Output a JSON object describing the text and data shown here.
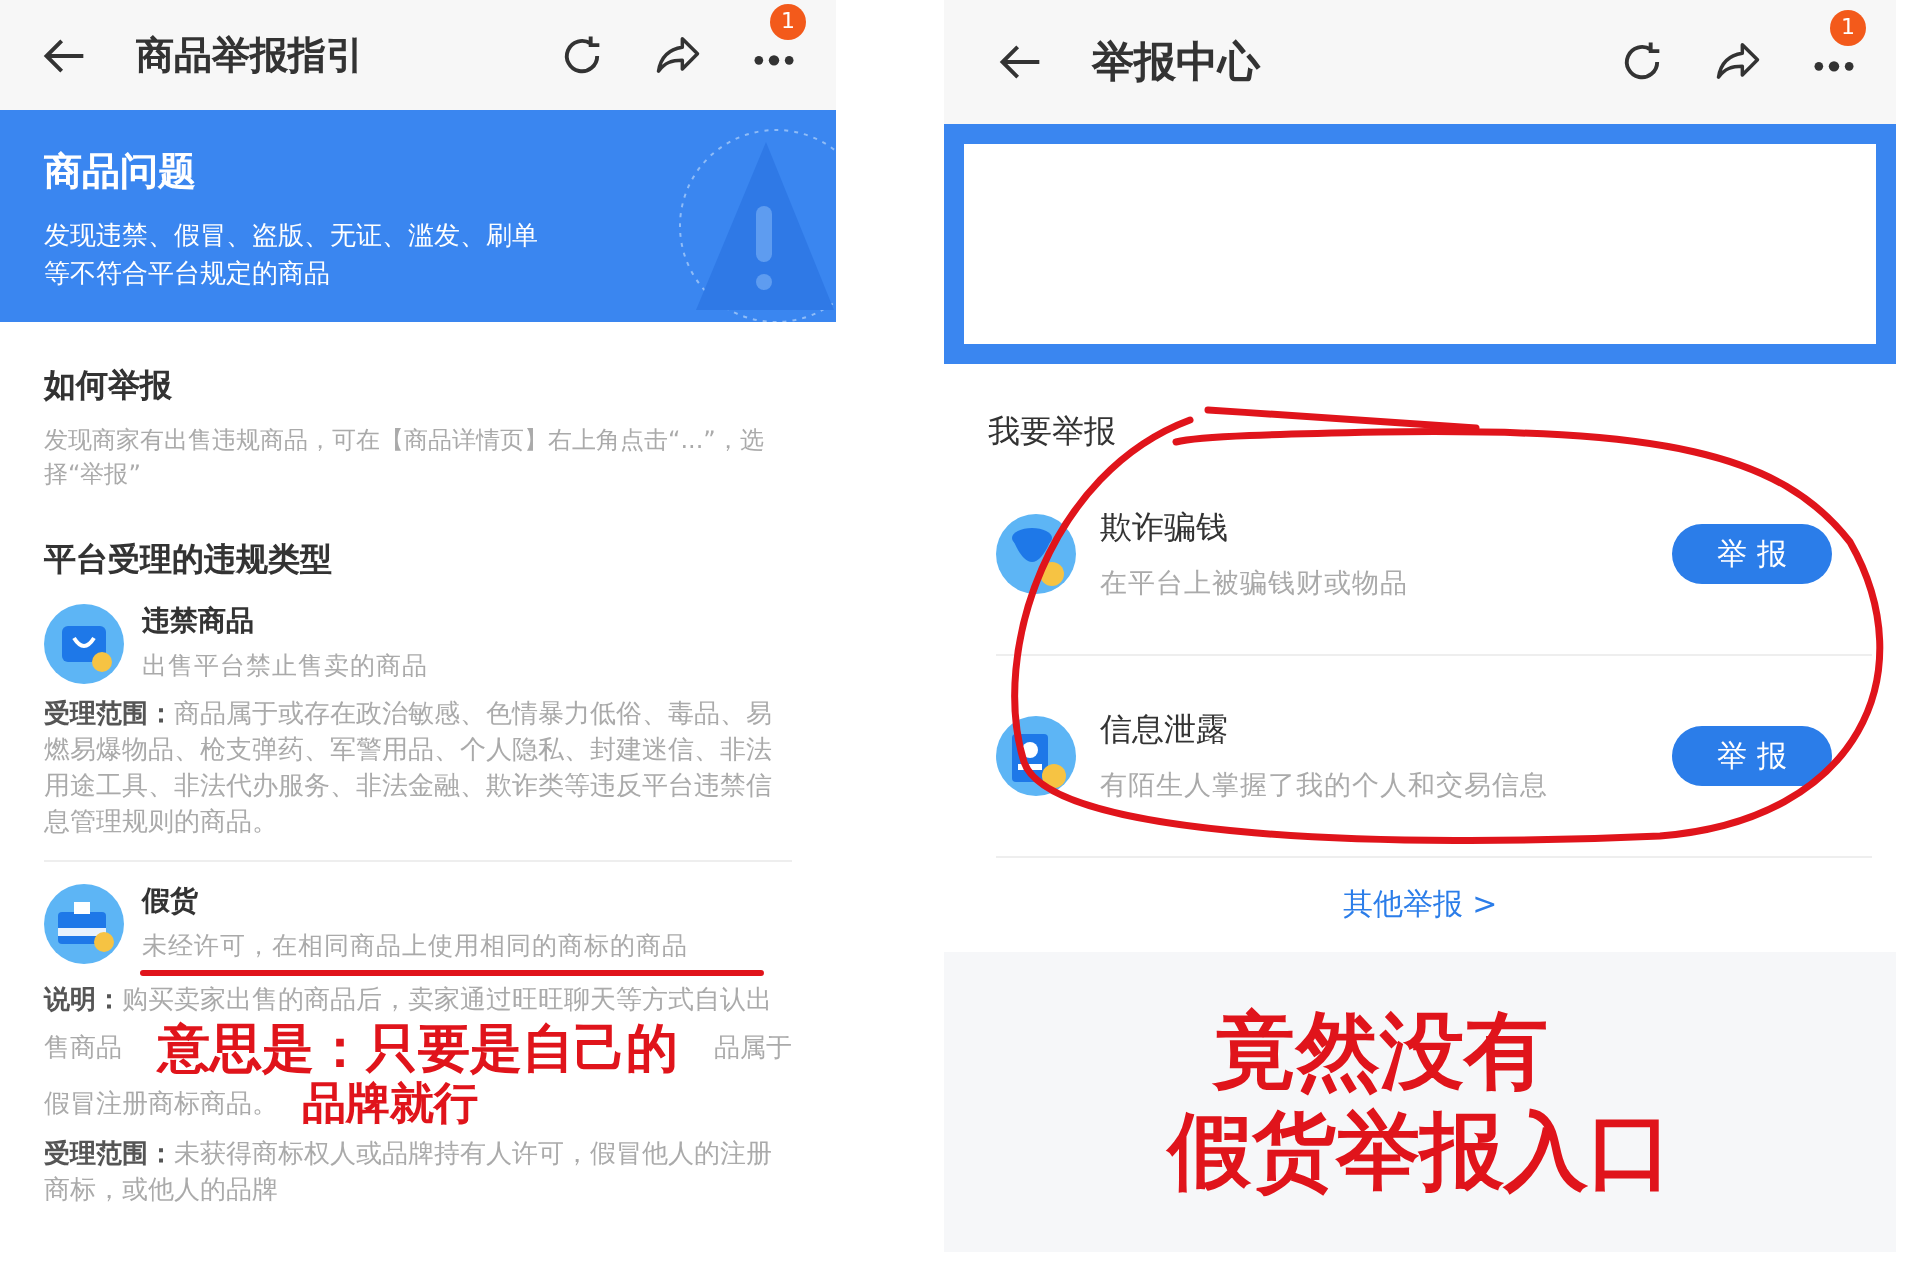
{
  "left_screen": {
    "header": {
      "title": "商品举报指引",
      "badge": "1"
    },
    "banner": {
      "title": "商品问题",
      "lines": [
        "发现违禁、假冒、盗版、无证、滥发、刷单",
        "等不符合平台规定的商品"
      ]
    },
    "how_to": {
      "heading": "如何举报",
      "text": "发现商家有出售违规商品，可在【商品详情页】右上角点击“...”，选择“举报”"
    },
    "types": {
      "heading": "平台受理的违规类型",
      "items": [
        {
          "title": "违禁商品",
          "subtitle": "出售平台禁止售卖的商品",
          "kind": "bag",
          "details": [
            {
              "label": "受理范围：",
              "text": "商品属于或存在政治敏感、色情暴力低俗、毒品、易燃易爆物品、枪支弹药、军警用品、个人隐私、封建迷信、非法用途工具、非法代办服务、非法金融、欺诈类等违反平台违禁信息管理规则的商品。"
            }
          ]
        },
        {
          "title": "假货",
          "subtitle": "未经许可，在相同商品上使用相同的商标的商品",
          "kind": "box",
          "details": [
            {
              "label": "说明：",
              "lines": [
                [
                  "购买卖家出售的商品后，卖家通过旺旺聊天等方式自认出"
                ],
                [
                  "售商品",
                  "品属于"
                ],
                [
                  "假冒注册商标商品。"
                ]
              ]
            },
            {
              "label": "受理范围：",
              "text": "未获得商标权人或品牌持有人许可，假冒他人的注册商标，或他人的品牌"
            }
          ]
        }
      ]
    }
  },
  "right_screen": {
    "header": {
      "title": "举报中心",
      "badge": "1"
    },
    "section_heading": "我要举报",
    "items": [
      {
        "title": "欺诈骗钱",
        "subtitle": "在平台上被骗钱财或物品",
        "button": "举 报",
        "kind": "money"
      },
      {
        "title": "信息泄露",
        "subtitle": "有陌生人掌握了我的个人和交易信息",
        "button": "举 报",
        "kind": "card"
      }
    ],
    "more_link": "其他举报 >"
  },
  "annotations": {
    "left_note": [
      "意思是：只要是自己的",
      "品牌就行"
    ],
    "caption": [
      "竟然没有",
      "假货举报入口"
    ]
  }
}
